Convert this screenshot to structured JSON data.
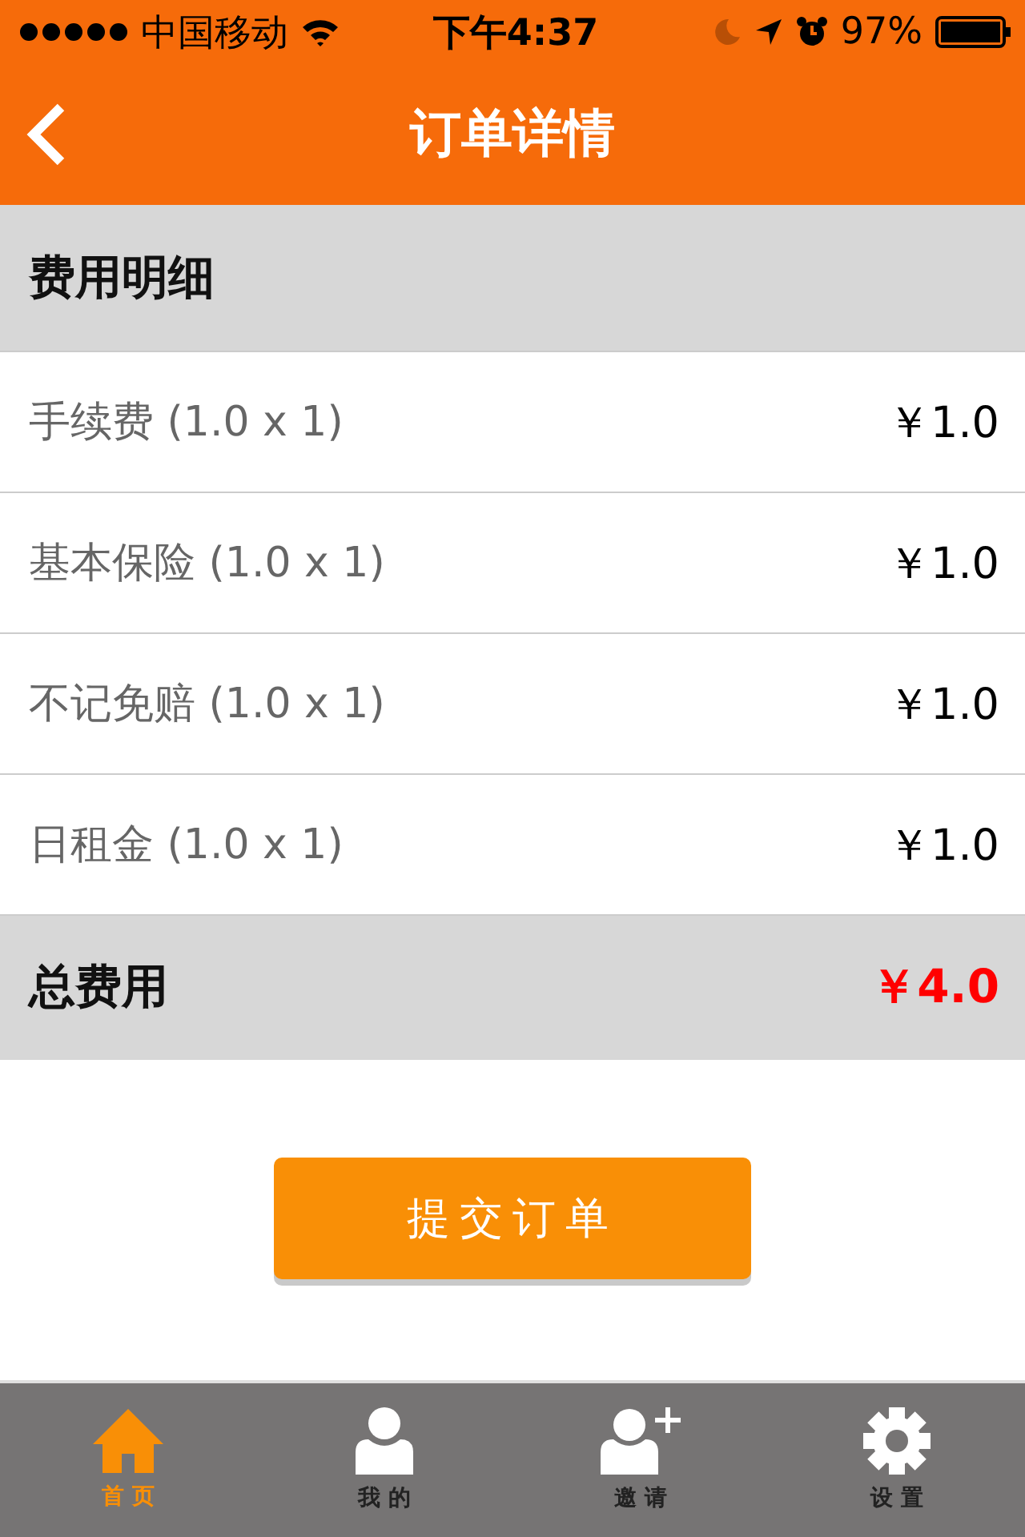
{
  "status_bar": {
    "carrier": "中国移动",
    "time": "下午4:37",
    "battery": "97%"
  },
  "nav": {
    "title": "订单详情"
  },
  "section": {
    "title": "费用明细"
  },
  "items": [
    {
      "label": "手续费 (1.0 x 1)",
      "price": "￥1.0"
    },
    {
      "label": "基本保险 (1.0 x 1)",
      "price": "￥1.0"
    },
    {
      "label": "不记免赔 (1.0 x 1)",
      "price": "￥1.0"
    },
    {
      "label": "日租金 (1.0 x 1)",
      "price": "￥1.0"
    }
  ],
  "total": {
    "label": "总费用",
    "price": "￥4.0"
  },
  "submit_button": "提交订单",
  "tabs": [
    {
      "label": "首 页",
      "kind": "home",
      "selected": true
    },
    {
      "label": "我 的",
      "kind": "person",
      "selected": false
    },
    {
      "label": "邀 请",
      "kind": "invite",
      "selected": false
    },
    {
      "label": "设 置",
      "kind": "settings",
      "selected": false
    }
  ]
}
